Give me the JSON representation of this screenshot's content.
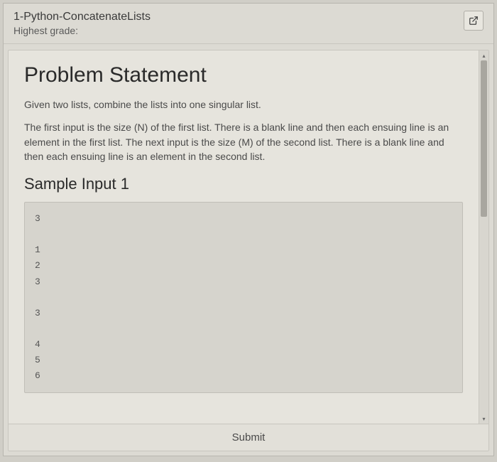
{
  "header": {
    "title": "1-Python-ConcatenateLists",
    "grade_label": "Highest grade:"
  },
  "problem": {
    "heading": "Problem Statement",
    "para1": "Given two lists, combine the lists into one singular list.",
    "para2": "The first input is the size (N) of the first list. There is a blank line and then each ensuing line is an element in the first list. The next input is the size (M) of the second list. There is a blank line and then each ensuing line is an element in the second list.",
    "sample_heading": "Sample Input 1",
    "sample_text": "3\n\n1\n2\n3\n\n3\n\n4\n5\n6"
  },
  "actions": {
    "submit": "Submit"
  }
}
